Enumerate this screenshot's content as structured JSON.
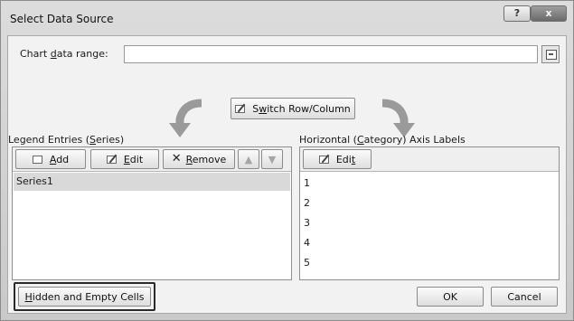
{
  "dialog": {
    "title": "Select Data Source",
    "help_glyph": "?",
    "close_glyph": "x"
  },
  "chart_range": {
    "label_pre": "Chart ",
    "label_u": "d",
    "label_post": "ata range:",
    "value": ""
  },
  "switch_button": {
    "pre": "S",
    "u": "w",
    "post": "itch Row/Column"
  },
  "legend": {
    "heading_pre": "Legend Entries (",
    "heading_u": "S",
    "heading_post": "eries)",
    "add_u": "A",
    "add_post": "dd",
    "edit_u": "E",
    "edit_post": "dit",
    "remove_u": "R",
    "remove_post": "emove",
    "items": [
      "Series1"
    ]
  },
  "axis": {
    "heading_pre": "Horizontal (",
    "heading_u": "C",
    "heading_post": "ategory) Axis Labels",
    "edit_pre": "Edi",
    "edit_u": "t",
    "items": [
      "1",
      "2",
      "3",
      "4",
      "5"
    ]
  },
  "footer": {
    "hidden_u": "H",
    "hidden_post": "idden and Empty Cells",
    "ok_label": "OK",
    "cancel_label": "Cancel"
  }
}
